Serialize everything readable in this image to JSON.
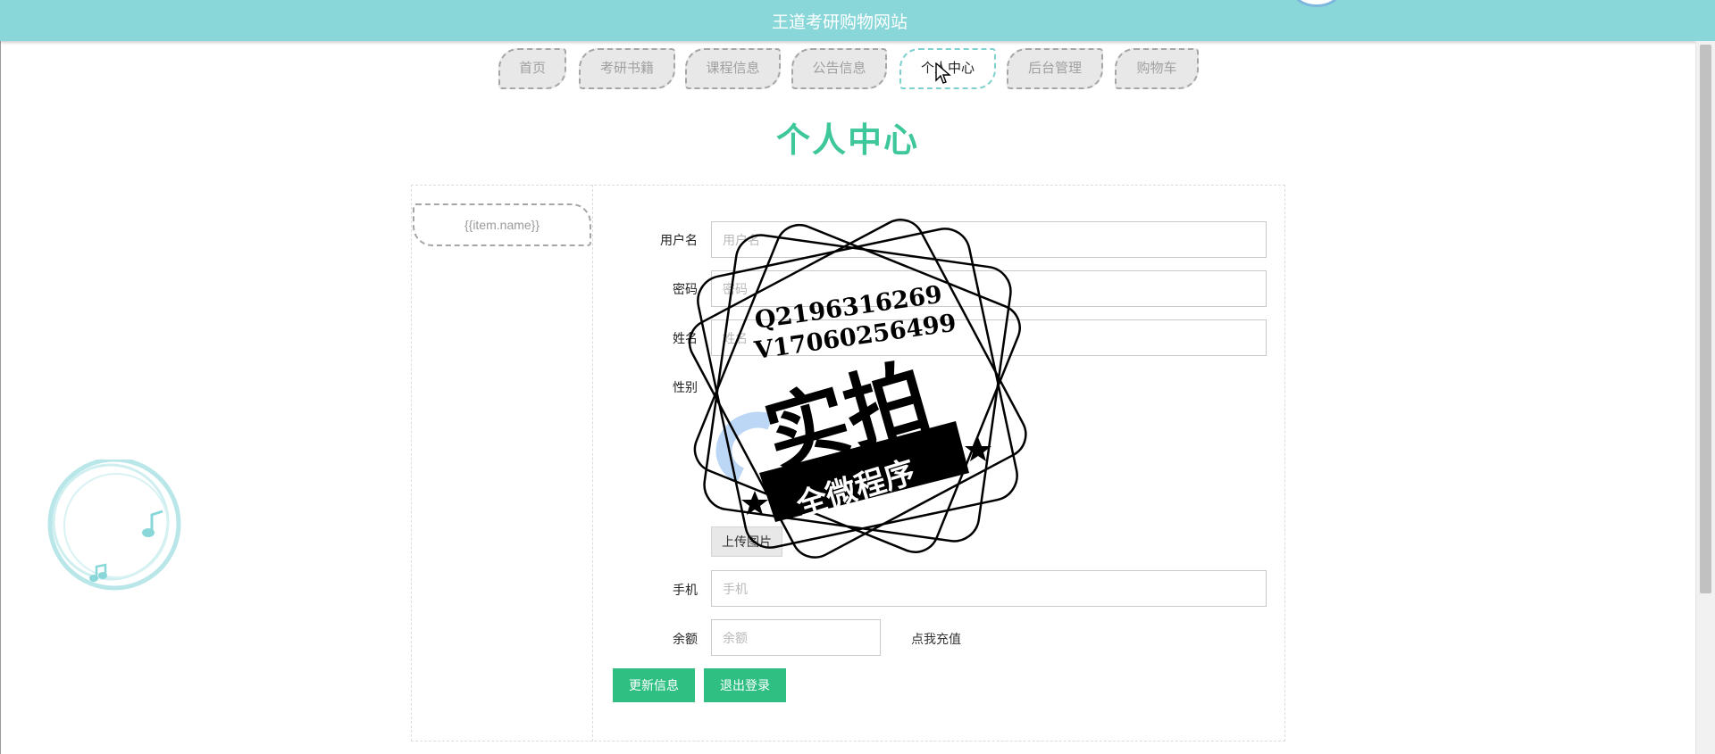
{
  "header": {
    "site_title": "王道考研购物网站"
  },
  "nav": {
    "items": [
      {
        "label": "首页",
        "active": false
      },
      {
        "label": "考研书籍",
        "active": false
      },
      {
        "label": "课程信息",
        "active": false
      },
      {
        "label": "公告信息",
        "active": false
      },
      {
        "label": "个人中心",
        "active": true
      },
      {
        "label": "后台管理",
        "active": false
      },
      {
        "label": "购物车",
        "active": false
      }
    ]
  },
  "page": {
    "heading": "个人中心"
  },
  "sidebar": {
    "menu_item": "{{item.name}}"
  },
  "form": {
    "username": {
      "label": "用户名",
      "placeholder": "用户名",
      "value": ""
    },
    "password": {
      "label": "密码",
      "placeholder": "密码",
      "value": ""
    },
    "name": {
      "label": "姓名",
      "placeholder": "姓名",
      "value": ""
    },
    "gender": {
      "label": "性别"
    },
    "upload_label": "上传图片",
    "phone": {
      "label": "手机",
      "placeholder": "手机",
      "value": ""
    },
    "balance": {
      "label": "余额",
      "placeholder": "余额",
      "value": ""
    },
    "recharge_link": "点我充值"
  },
  "actions": {
    "update": "更新信息",
    "logout": "退出登录"
  },
  "watermark": {
    "line1": "Q2196316269",
    "line2": "V17060256499",
    "main": "实拍",
    "banner": "全微程序"
  },
  "colors": {
    "header_bg": "#8ad7d9",
    "accent_green": "#2fbf83",
    "heading_green": "#3fc79c"
  }
}
